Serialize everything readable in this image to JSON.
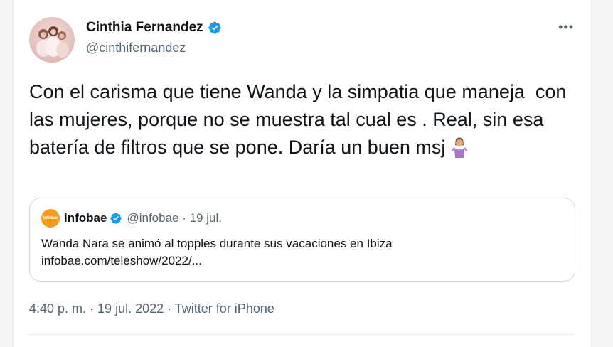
{
  "author": {
    "display_name": "Cinthia Fernandez",
    "handle": "@cinthifernandez",
    "verified": true,
    "avatar_icon": "profile-photo"
  },
  "more_icon": "more-options-icon",
  "more_glyph": "•••",
  "tweet": {
    "text": "Con el carisma que tiene Wanda y la simpatia que maneja  con las mujeres, porque no se muestra tal cual es . Real, sin esa batería de filtros que se pone. Daría un buen msj",
    "emoji": "person-shrugging-emoji"
  },
  "quoted_tweet": {
    "logo_text": "infobae",
    "author_name": "infobae",
    "verified": true,
    "handle_date": "@infobae · 19 jul.",
    "text_line1": "Wanda Nara se animó al topples durante sus vacaciones en Ibiza",
    "text_line2": "infobae.com/teleshow/2022/..."
  },
  "meta": {
    "time": "4:40 p. m.",
    "separator": " · ",
    "date": "19 jul. 2022",
    "source": "Twitter for iPhone"
  },
  "colors": {
    "verified_blue": "#1d9bf0",
    "infobae_orange": "#f39c1f",
    "secondary_text": "#536471"
  }
}
